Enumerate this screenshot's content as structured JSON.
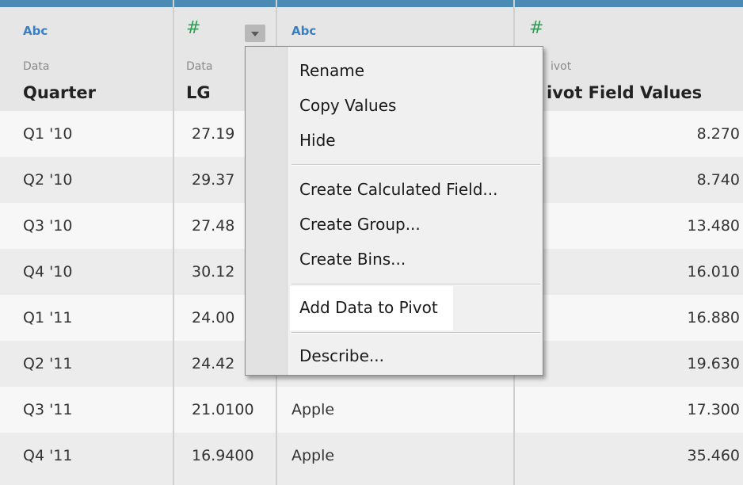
{
  "columns": [
    {
      "type": "Abc",
      "source": "Data",
      "name": "Quarter"
    },
    {
      "type": "#",
      "source": "Data",
      "name": "LG"
    },
    {
      "type": "Abc",
      "source": "",
      "name": ""
    },
    {
      "type": "#",
      "source": "ivot",
      "name": "ivot Field Values"
    }
  ],
  "rows": [
    {
      "quarter": "Q1 '10",
      "lg": "27.19",
      "brand": "",
      "value": "8.270"
    },
    {
      "quarter": "Q2 '10",
      "lg": "29.37",
      "brand": "",
      "value": "8.740"
    },
    {
      "quarter": "Q3 '10",
      "lg": "27.48",
      "brand": "",
      "value": "13.480"
    },
    {
      "quarter": "Q4 '10",
      "lg": "30.12",
      "brand": "",
      "value": "16.010"
    },
    {
      "quarter": "Q1 '11",
      "lg": "24.00",
      "brand": "",
      "value": "16.880"
    },
    {
      "quarter": "Q2 '11",
      "lg": "24.42",
      "brand": "",
      "value": "19.630"
    },
    {
      "quarter": "Q3 '11",
      "lg": "21.0100",
      "brand": "Apple",
      "value": "17.300"
    },
    {
      "quarter": "Q4 '11",
      "lg": "16.9400",
      "brand": "Apple",
      "value": "35.460"
    }
  ],
  "context_menu": {
    "items": [
      "Rename",
      "Copy Values",
      "Hide",
      "Create Calculated Field...",
      "Create Group...",
      "Create Bins...",
      "Add Data to Pivot",
      "Describe..."
    ],
    "highlighted": "Add Data to Pivot"
  },
  "colors": {
    "header_bar": "#4a8ab5",
    "string_type": "#3a7fbf",
    "number_type": "#2f9e54"
  }
}
